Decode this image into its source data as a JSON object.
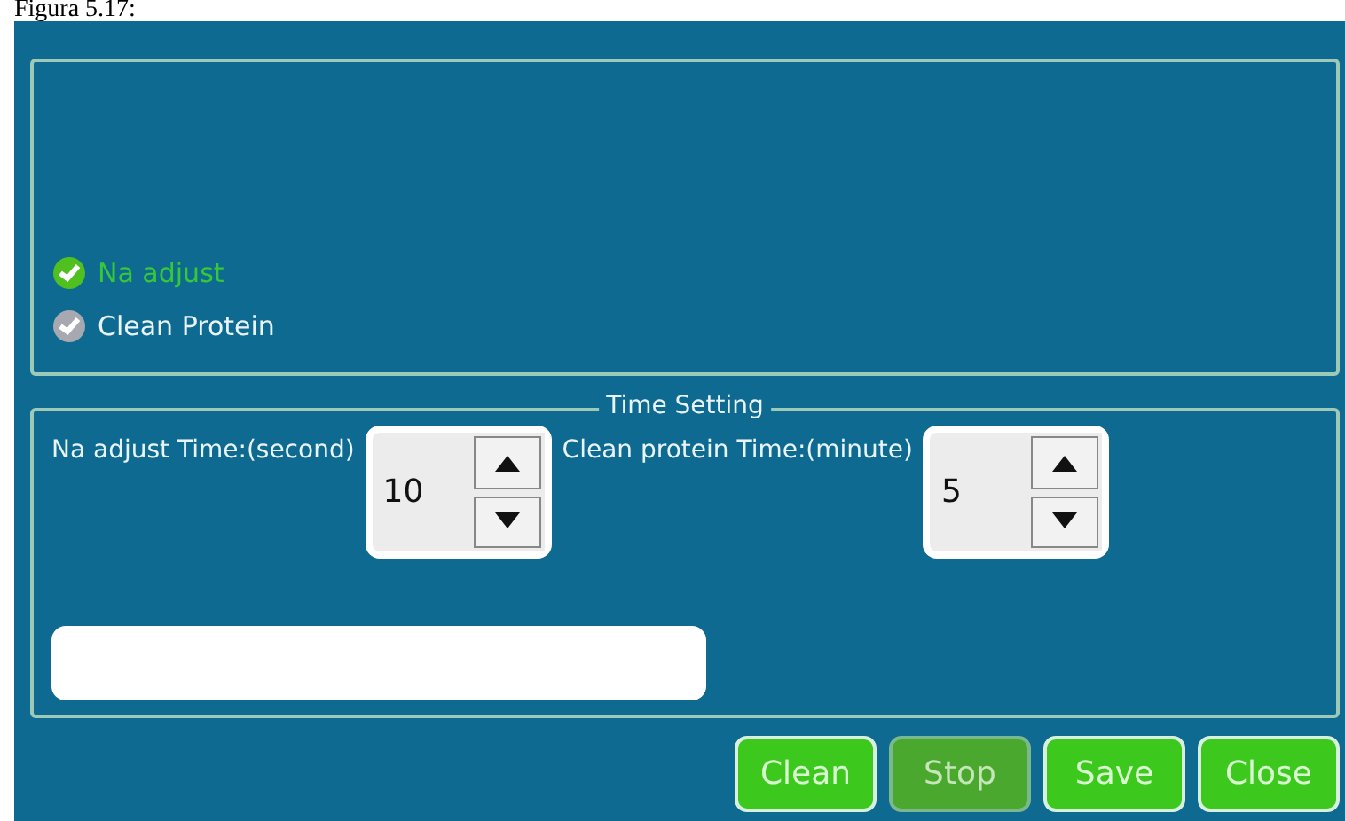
{
  "caption": "Figura 5.17:",
  "modes": [
    {
      "label": "Na adjust",
      "selected": true
    },
    {
      "label": "Clean Protein",
      "selected": false
    }
  ],
  "time_setting": {
    "title": "Time Setting",
    "spinners": [
      {
        "label": "Na adjust Time:(second)",
        "value": "10"
      },
      {
        "label": "Clean protein Time:(minute)",
        "value": "5"
      }
    ]
  },
  "buttons": [
    {
      "label": "Clean",
      "disabled": false
    },
    {
      "label": "Stop",
      "disabled": true
    },
    {
      "label": "Save",
      "disabled": false
    },
    {
      "label": "Close",
      "disabled": false
    }
  ]
}
